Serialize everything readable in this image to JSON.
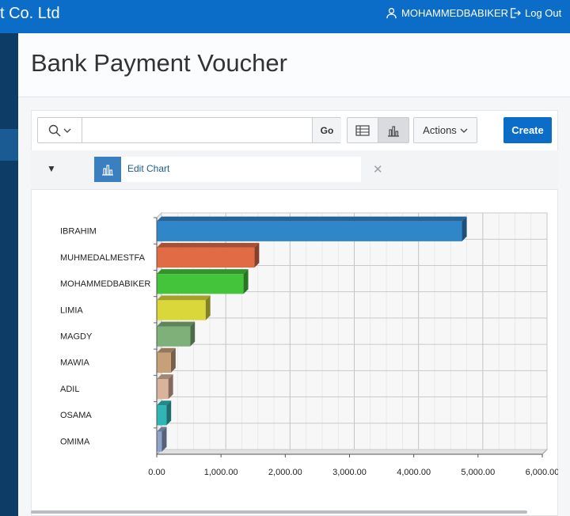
{
  "header": {
    "brand": "t Co. Ltd",
    "user_name": "MOHAMMEDBABIKER",
    "logout_label": "Log Out"
  },
  "page": {
    "title": "Bank Payment Voucher"
  },
  "toolbar": {
    "search_value": "",
    "go_label": "Go",
    "actions_label": "Actions",
    "create_label": "Create"
  },
  "controls": {
    "edit_chart_label": "Edit Chart"
  },
  "icons": {
    "user": "user-icon",
    "logout": "logout-icon",
    "search": "search-icon",
    "grid_view": "grid-view-icon",
    "chart_view": "bar-chart-icon",
    "remove": "close-icon"
  },
  "colors": {
    "header": "#0b6dc8",
    "sidebar": "#0d3d66",
    "create_button": "#0b6dc8"
  },
  "chart_data": {
    "type": "bar",
    "orientation": "horizontal",
    "categories": [
      "IBRAHIM",
      "MUHMEDALMESTFA",
      "MOHAMMEDBABIKER",
      "LIMIA",
      "MAGDY",
      "MAWIA",
      "ADIL",
      "OSAMA",
      "OMIMA"
    ],
    "values": [
      4750,
      1520,
      1350,
      760,
      520,
      220,
      180,
      150,
      80
    ],
    "colors": [
      "#2f86c8",
      "#e06b45",
      "#43c43b",
      "#d9d73a",
      "#7fb07a",
      "#c7a07a",
      "#d9b39b",
      "#2fb5b5",
      "#8fa3cc"
    ],
    "xlim": [
      0,
      6000
    ],
    "x_ticks": [
      "0.00",
      "1,000.00",
      "2,000.00",
      "3,000.00",
      "4,000.00",
      "5,000.00",
      "6,000.00"
    ],
    "grid": true,
    "title": "",
    "xlabel": "",
    "ylabel": ""
  }
}
